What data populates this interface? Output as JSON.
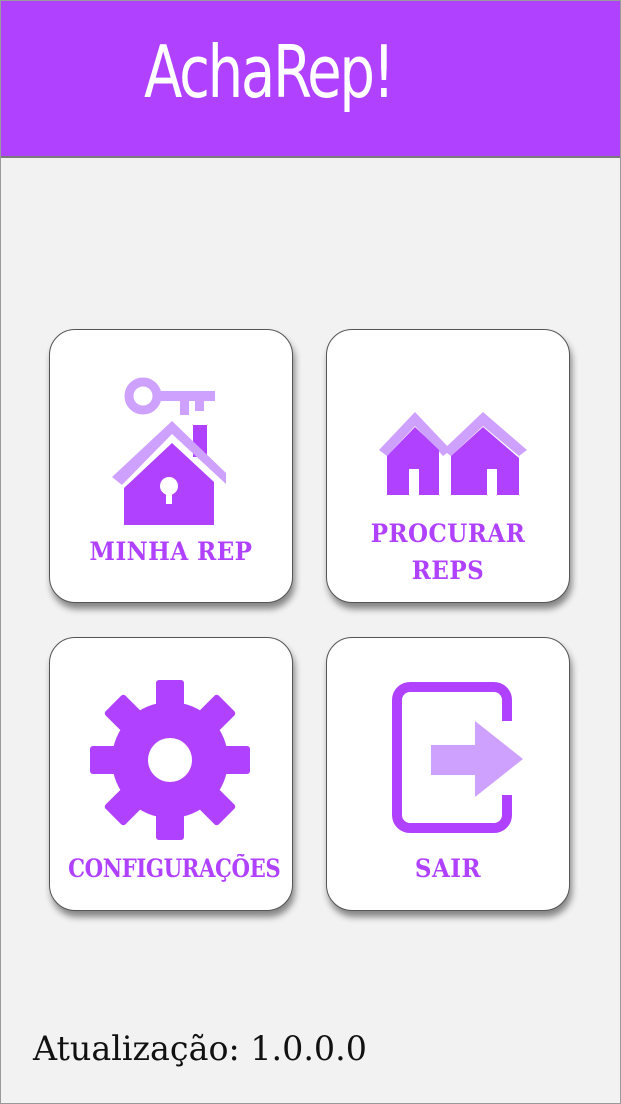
{
  "app": {
    "title": "AchaRep!"
  },
  "colors": {
    "accent": "#b042ff",
    "accent_light": "#cfa1ff",
    "background": "#f2f2f2",
    "tile_background": "#ffffff"
  },
  "menu": {
    "tiles": [
      {
        "label": "MINHA REP",
        "icon": "house-key-icon"
      },
      {
        "label_line1": "PROCURAR",
        "label_line2": "REPS",
        "icon": "houses-icon"
      },
      {
        "label": "CONFIGURAÇÕES",
        "icon": "gear-icon"
      },
      {
        "label": "SAIR",
        "icon": "exit-icon"
      }
    ]
  },
  "footer": {
    "version_text": "Atualização: 1.0.0.0"
  }
}
